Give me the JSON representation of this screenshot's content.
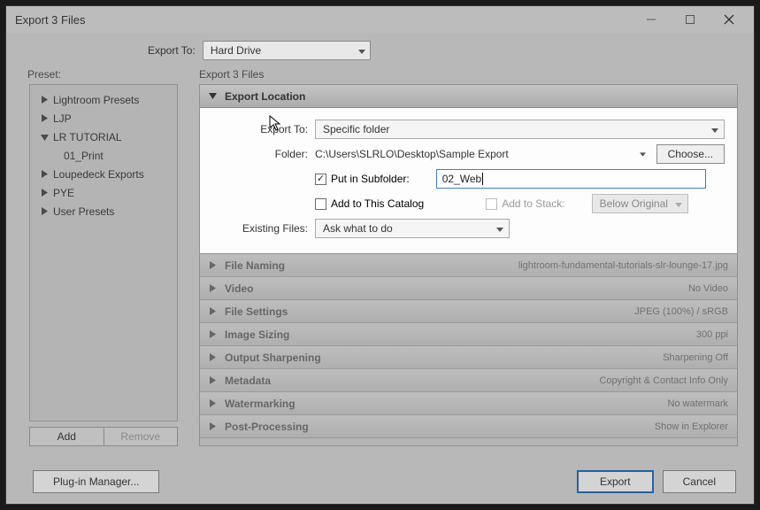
{
  "window": {
    "title": "Export 3 Files"
  },
  "exportTo": {
    "label": "Export To:",
    "value": "Hard Drive"
  },
  "presets": {
    "heading": "Preset:",
    "items": [
      {
        "label": "Lightroom Presets",
        "expanded": false
      },
      {
        "label": "LJP",
        "expanded": false
      },
      {
        "label": "LR TUTORIAL",
        "expanded": true,
        "children": [
          {
            "label": "01_Print"
          }
        ]
      },
      {
        "label": "Loupedeck Exports",
        "expanded": false
      },
      {
        "label": "PYE",
        "expanded": false
      },
      {
        "label": "User Presets",
        "expanded": false
      }
    ],
    "addBtn": "Add",
    "removeBtn": "Remove"
  },
  "rightHeading": "Export 3 Files",
  "exportLocation": {
    "panelTitle": "Export Location",
    "exportToLabel": "Export To:",
    "exportToValue": "Specific folder",
    "folderLabel": "Folder:",
    "folderPath": "C:\\Users\\SLRLO\\Desktop\\Sample Export",
    "chooseBtn": "Choose...",
    "putInSubfolderLabel": "Put in Subfolder:",
    "subfolderValue": "02_Web",
    "addToCatalogLabel": "Add to This Catalog",
    "addToStackLabel": "Add to Stack:",
    "stackPos": "Below Original",
    "existingFilesLabel": "Existing Files:",
    "existingFilesValue": "Ask what to do"
  },
  "collapsedPanels": [
    {
      "title": "File Naming",
      "summary": "lightroom-fundamental-tutorials-slr-lounge-17.jpg"
    },
    {
      "title": "Video",
      "summary": "No Video"
    },
    {
      "title": "File Settings",
      "summary": "JPEG (100%) / sRGB"
    },
    {
      "title": "Image Sizing",
      "summary": "300 ppi"
    },
    {
      "title": "Output Sharpening",
      "summary": "Sharpening Off"
    },
    {
      "title": "Metadata",
      "summary": "Copyright & Contact Info Only"
    },
    {
      "title": "Watermarking",
      "summary": "No watermark"
    },
    {
      "title": "Post-Processing",
      "summary": "Show in Explorer"
    }
  ],
  "footer": {
    "pluginManager": "Plug-in Manager...",
    "export": "Export",
    "cancel": "Cancel"
  }
}
